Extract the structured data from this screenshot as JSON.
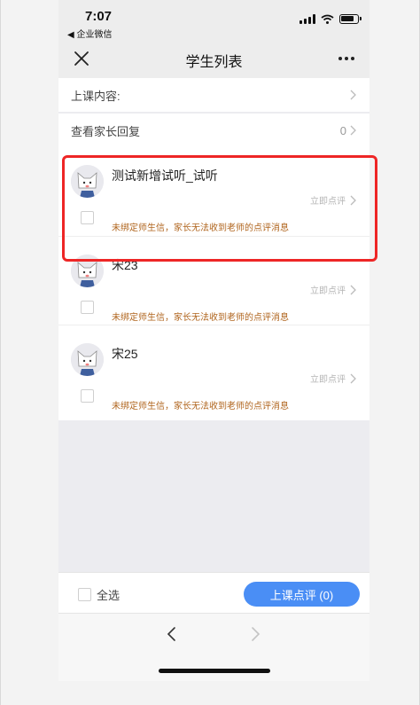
{
  "status_bar": {
    "time": "7:07",
    "back_app": "◀ 企业微信",
    "icons": [
      "signal-icon",
      "wifi-icon",
      "battery-icon"
    ]
  },
  "nav": {
    "title": "学生列表",
    "close_icon": "close-icon",
    "more_icon": "more-icon"
  },
  "rows": {
    "lesson_content_label": "上课内容:",
    "parent_reply_label": "查看家长回复",
    "parent_reply_count": "0"
  },
  "students": [
    {
      "name": "测试新增试听_试听",
      "comment_label": "立即点评",
      "warning": "未绑定师生信，家长无法收到老师的点评消息"
    },
    {
      "name": "宋23",
      "comment_label": "立即点评",
      "warning": "未绑定师生信，家长无法收到老师的点评消息"
    },
    {
      "name": "宋25",
      "comment_label": "立即点评",
      "warning": "未绑定师生信，家长无法收到老师的点评消息"
    }
  ],
  "footer": {
    "select_all_label": "全选",
    "submit_label": "上课点评 (0)"
  },
  "colors": {
    "accent": "#4a8ef5",
    "warning_text": "#b0651e",
    "highlight_border": "#ee2626",
    "nav_background": "#ededed"
  }
}
